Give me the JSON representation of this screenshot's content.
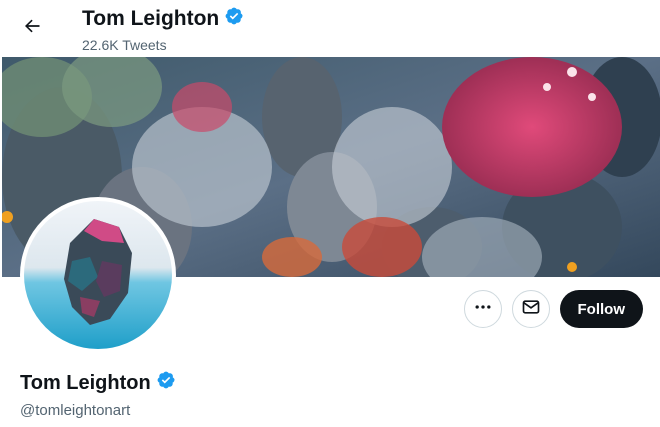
{
  "header": {
    "display_name": "Tom Leighton",
    "tweets_count": "22.6K Tweets"
  },
  "profile": {
    "display_name": "Tom Leighton",
    "handle": "@tomleightonart",
    "verified": true
  },
  "actions": {
    "more_icon": "more-icon",
    "message_icon": "message-icon",
    "follow_label": "Follow"
  },
  "colors": {
    "verified": "#1d9bf0",
    "follow_bg": "#0f1419",
    "muted_text": "#536471"
  }
}
